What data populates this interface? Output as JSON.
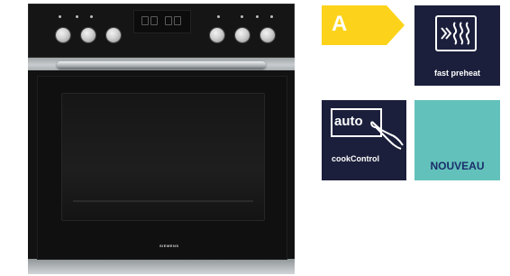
{
  "product": {
    "brand_label": "SIEMENS"
  },
  "energy_label": {
    "class": "A",
    "color": "#fcd31a"
  },
  "badges": {
    "fast_preheat": {
      "label": "fast preheat",
      "icon": "preheat-icon",
      "background": "#1b1f3b"
    },
    "cook_control": {
      "icon_text": "auto",
      "label": "cookControl",
      "icon": "hand-pointer-icon",
      "background": "#1b1f3b"
    },
    "new": {
      "label": "NOUVEAU",
      "background": "#62c2bb",
      "text_color": "#1b2e6b"
    }
  }
}
